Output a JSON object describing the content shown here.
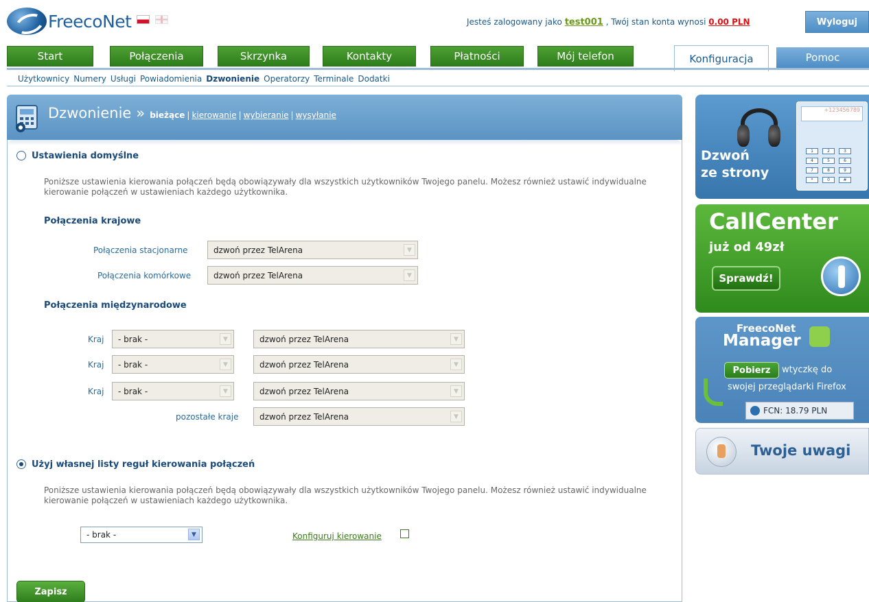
{
  "header": {
    "logo_text": "FreecoNet",
    "login_prefix": "Jesteś zalogowany jako",
    "username": "test001",
    "balance_prefix": ", Twój stan konta wynosi",
    "balance": "0.00 PLN",
    "logout_label": "Wyloguj"
  },
  "tabs": [
    "Start",
    "Połączenia",
    "Skrzynka",
    "Kontakty",
    "Płatności",
    "Mój telefon"
  ],
  "tab_active": "Konfiguracja",
  "tab_help": "Pomoc",
  "subnav": [
    "Użytkownicy",
    "Numery",
    "Usługi",
    "Powiadomienia",
    "Dzwonienie",
    "Operatorzy",
    "Terminale",
    "Dodatki"
  ],
  "subnav_current": "Dzwonienie",
  "page": {
    "title": "Dzwonienie",
    "arrow": "»",
    "current": "bieżące",
    "links": [
      "kierowanie",
      "wybieranie",
      "wysyłanie"
    ]
  },
  "default_section": {
    "title": "Ustawienia domyślne",
    "selected": false,
    "description": "Poniższe ustawienia kierowania połączeń będą obowiązywały dla wszystkich użytkowników Twojego panelu. Możesz również ustawić indywidualne kierowanie połączeń w ustawieniach każdego użytkownika.",
    "domestic_title": "Połączenia krajowe",
    "landline_label": "Połączenia stacjonarne",
    "landline_value": "dzwoń przez TelArena",
    "mobile_label": "Połączenia komórkowe",
    "mobile_value": "dzwoń przez TelArena",
    "intl_title": "Połączenia międzynarodowe",
    "country_label": "Kraj",
    "country_rows": [
      {
        "country": "- brak -",
        "route": "dzwoń przez TelArena"
      },
      {
        "country": "- brak -",
        "route": "dzwoń przez TelArena"
      },
      {
        "country": "- brak -",
        "route": "dzwoń przez TelArena"
      }
    ],
    "other_label": "pozostałe kraje",
    "other_value": "dzwoń przez TelArena"
  },
  "custom_section": {
    "title": "Użyj własnej listy reguł kierowania połączeń",
    "selected": true,
    "description": "Poniższe ustawienia kierowania połączeń będą obowiązywały dla wszystkich użytkowników Twojego panelu. Możesz również ustawić indywidualne kierowanie połączeń w ustawieniach każdego użytkownika.",
    "rules_value": "- brak -",
    "config_link": "Konfiguruj kierowanie"
  },
  "save_label": "Zapisz",
  "banners": {
    "dzwon_line1": "Dzwoń",
    "dzwon_line2": "ze strony",
    "phone_number": "+123456789",
    "keypad": [
      "1",
      "2",
      "3",
      "4",
      "5",
      "6",
      "7",
      "8",
      "9",
      "*",
      "0",
      "#"
    ],
    "call_title": "CallCenter",
    "call_sub": "już od 49zł",
    "call_btn": "Sprawdź!",
    "mgr_brand": "FreecoNet",
    "mgr_title": "Manager",
    "mgr_btn": "Pobierz",
    "mgr_text1": "wtyczkę do",
    "mgr_text2": "swojej przeglądarki Firefox",
    "mgr_fcn": "FCN: 18.79 PLN",
    "uwagi": "Twoje uwagi"
  },
  "colors": {
    "tab_green": "#2e7d1c",
    "header_blue": "#5b93c3",
    "link_blue": "#1a5a8a",
    "balance_red": "#dd1111"
  }
}
